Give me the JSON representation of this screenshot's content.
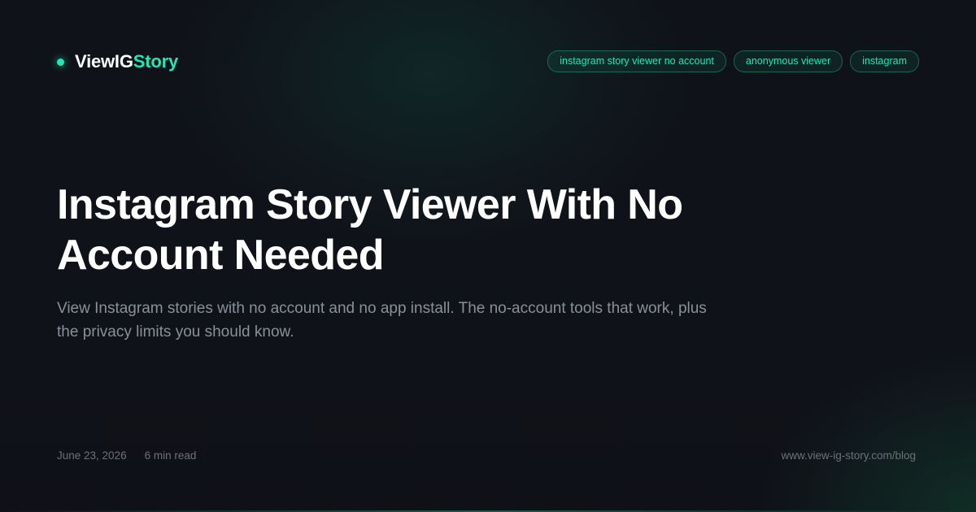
{
  "brand": {
    "name_primary": "ViewIG",
    "name_accent": "Story",
    "accent_color": "#1de9b6"
  },
  "tags": [
    "instagram story viewer no account",
    "anonymous viewer",
    "instagram"
  ],
  "article": {
    "title": "Instagram Story Viewer With No Account Needed",
    "description": "View Instagram stories with no account and no app install. The no-account tools that work, plus the privacy limits you should know.",
    "date": "June 23, 2026",
    "read_time": "6 min read"
  },
  "site": {
    "url": "www.view-ig-story.com/blog"
  },
  "colors": {
    "background": "#0f1117",
    "title": "#ffffff",
    "body_text": "#8a8f9b",
    "muted_text": "#6c717c"
  }
}
